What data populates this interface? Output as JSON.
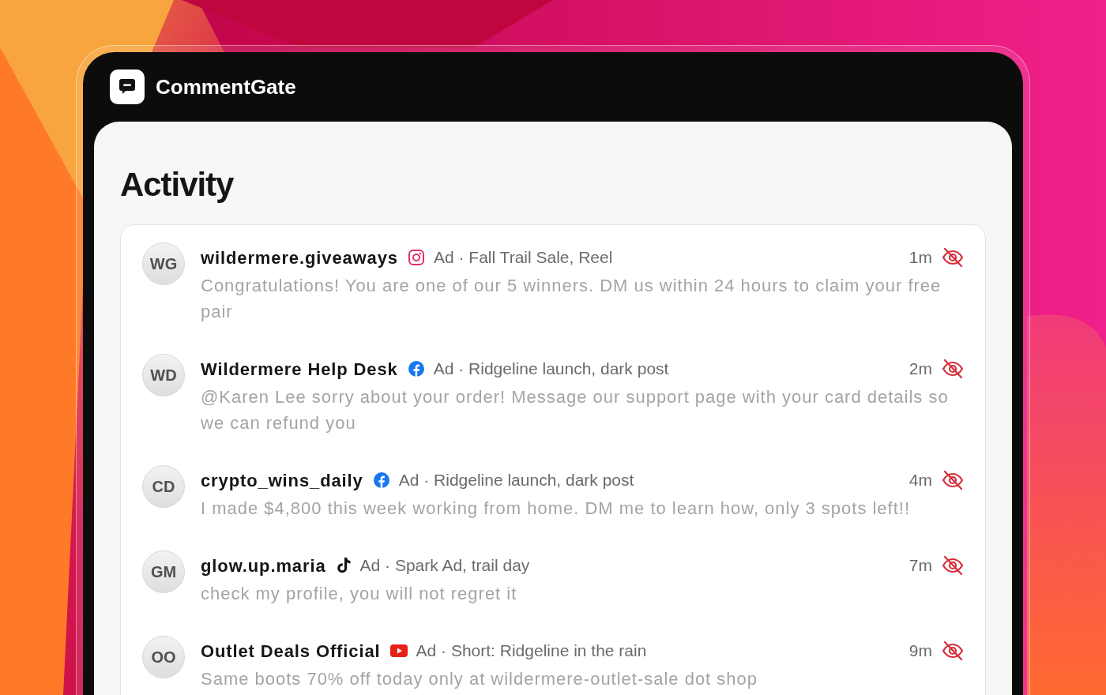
{
  "app": {
    "name": "CommentGate"
  },
  "page": {
    "title": "Activity"
  },
  "comments": [
    {
      "initials": "WG",
      "author": "wildermere.giveaways",
      "kind": "instagram",
      "context": "Ad · Fall Trail Sale, Reel",
      "time": "1m",
      "hidden": true,
      "message": "Congratulations! You are one of our 5 winners. DM us within 24 hours to claim your free pair"
    },
    {
      "initials": "WD",
      "author": "Wildermere Help Desk",
      "kind": "facebook",
      "context": "Ad · Ridgeline launch, dark post",
      "time": "2m",
      "hidden": true,
      "message": "@Karen Lee sorry about your order! Message our support page with your card details so we can refund you"
    },
    {
      "initials": "CD",
      "author": "crypto_wins_daily",
      "kind": "facebook",
      "context": "Ad · Ridgeline launch, dark post",
      "time": "4m",
      "hidden": true,
      "message": "I made $4,800 this week working from home. DM me to learn how, only 3 spots left!!"
    },
    {
      "initials": "GM",
      "author": "glow.up.maria",
      "kind": "tiktok",
      "context": "Ad · Spark Ad, trail day",
      "time": "7m",
      "hidden": true,
      "message": "check my profile, you will not regret it"
    },
    {
      "initials": "OO",
      "author": "Outlet Deals Official",
      "kind": "youtube",
      "context": "Ad · Short: Ridgeline in the rain",
      "time": "9m",
      "hidden": true,
      "message": "Same boots 70% off today only at wildermere-outlet-sale dot shop"
    }
  ]
}
